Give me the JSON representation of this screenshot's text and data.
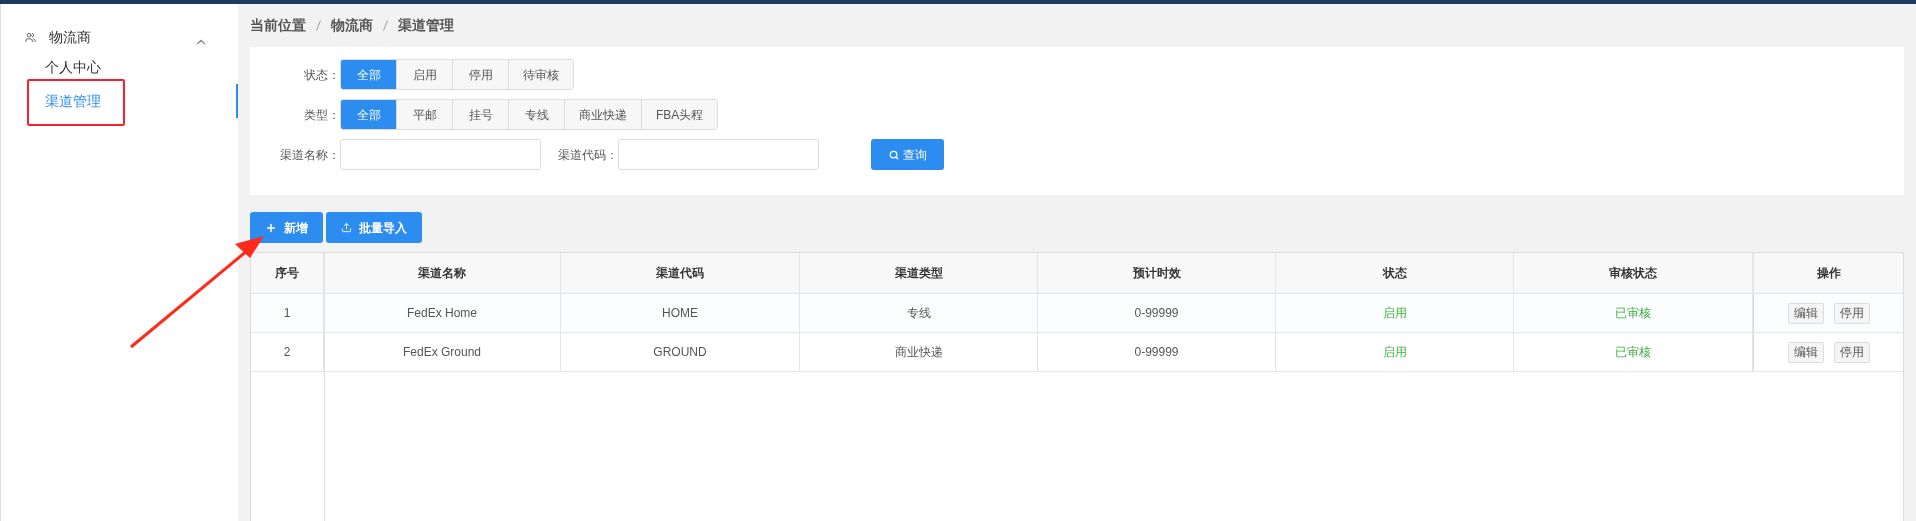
{
  "sidebar": {
    "group": {
      "label": "物流商",
      "expanded": true
    },
    "items": [
      {
        "label": "个人中心",
        "selected": false
      },
      {
        "label": "渠道管理",
        "selected": true
      }
    ]
  },
  "breadcrumb": [
    "当前位置",
    "物流商",
    "渠道管理"
  ],
  "filters": [
    {
      "label": "状态：",
      "options": [
        {
          "label": "全部",
          "selected": true
        },
        {
          "label": "启用",
          "selected": false
        },
        {
          "label": "停用",
          "selected": false
        },
        {
          "label": "待审核",
          "selected": false
        }
      ]
    },
    {
      "label": "类型：",
      "options": [
        {
          "label": "全部",
          "selected": true
        },
        {
          "label": "平邮",
          "selected": false
        },
        {
          "label": "挂号",
          "selected": false
        },
        {
          "label": "专线",
          "selected": false
        },
        {
          "label": "商业快递",
          "selected": false
        },
        {
          "label": "FBA头程",
          "selected": false
        }
      ]
    }
  ],
  "fields": [
    {
      "label": "渠道名称："
    },
    {
      "label": "渠道代码："
    }
  ],
  "search_button": "查询",
  "actions": [
    "新增",
    "批量导入"
  ],
  "table": {
    "columns": [
      "序号",
      "渠道名称",
      "渠道代码",
      "渠道类型",
      "预计时效",
      "状态",
      "审核状态",
      "操作"
    ],
    "rows": [
      {
        "cells": [
          "1",
          "FedEx Home",
          "HOME",
          "专线",
          "0-99999",
          "启用",
          "已审核"
        ],
        "buttons": [
          "编辑",
          "停用"
        ]
      },
      {
        "cells": [
          "2",
          "FedEx Ground",
          "GROUND",
          "商业快递",
          "0-99999",
          "启用",
          "已审核"
        ],
        "buttons": [
          "编辑",
          "停用"
        ]
      }
    ]
  }
}
